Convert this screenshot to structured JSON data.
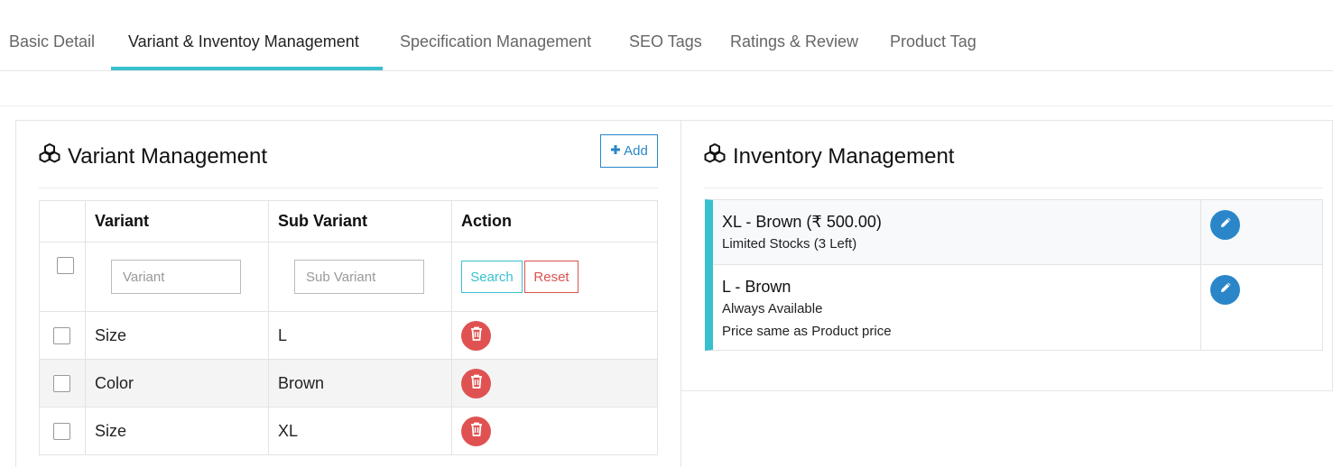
{
  "tabs": [
    {
      "label": "Basic Detail",
      "active": false
    },
    {
      "label": "Variant & Inventoy Management",
      "active": true
    },
    {
      "label": "Specification Management",
      "active": false
    },
    {
      "label": "SEO Tags",
      "active": false
    },
    {
      "label": "Ratings & Review",
      "active": false
    },
    {
      "label": "Product Tag",
      "active": false
    }
  ],
  "variant_panel": {
    "title": "Variant Management",
    "add_label": "Add",
    "columns": [
      "Variant",
      "Sub Variant",
      "Action"
    ],
    "filter": {
      "variant_placeholder": "Variant",
      "sub_variant_placeholder": "Sub Variant",
      "search_label": "Search",
      "reset_label": "Reset"
    },
    "rows": [
      {
        "variant": "Size",
        "sub_variant": "L"
      },
      {
        "variant": "Color",
        "sub_variant": "Brown"
      },
      {
        "variant": "Size",
        "sub_variant": "XL"
      }
    ]
  },
  "inventory_panel": {
    "title": "Inventory Management",
    "items": [
      {
        "title": "XL - Brown (₹ 500.00)",
        "lines": [
          "Limited Stocks (3 Left)"
        ]
      },
      {
        "title": "L - Brown",
        "lines": [
          "Always Available",
          "Price same as Product price"
        ]
      }
    ]
  },
  "colors": {
    "accent": "#39c0ce",
    "primary": "#2a86c8",
    "danger": "#e05252"
  }
}
